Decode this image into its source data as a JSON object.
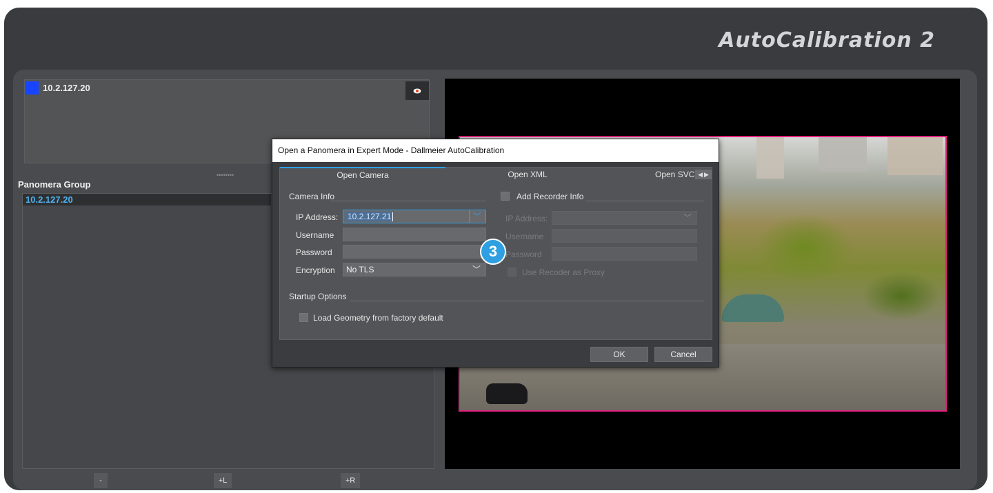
{
  "app": {
    "title": "AutoCalibration 2"
  },
  "camera_card": {
    "ip": "10.2.127.20",
    "color": "#1744ff",
    "eye_icon": "eye-icon"
  },
  "group": {
    "label": "Panomera Group",
    "items": [
      {
        "label": "10.2.127.20"
      }
    ]
  },
  "bottom_buttons": {
    "minus": "-",
    "plus_l": "+L",
    "plus_r": "+R"
  },
  "dialog": {
    "title": "Open a Panomera in Expert Mode - Dallmeier AutoCalibration",
    "tabs": [
      {
        "label": "Open Camera",
        "active": true
      },
      {
        "label": "Open XML",
        "active": false
      },
      {
        "label": "Open SVC",
        "active": false
      }
    ],
    "camera_info": {
      "section": "Camera Info",
      "ip_label": "IP Address:",
      "ip_value": "10.2.127.21",
      "username_label": "Username",
      "username_value": "",
      "password_label": "Password",
      "password_value": "",
      "encryption_label": "Encryption",
      "encryption_value": "No TLS"
    },
    "recorder_info": {
      "section": "Add Recorder Info",
      "checked": false,
      "ip_label": "IP Address:",
      "username_label": "Username",
      "password_label": "Password",
      "proxy_label": "Use Recoder as Proxy"
    },
    "startup": {
      "section": "Startup Options",
      "load_geometry_label": "Load Geometry from factory default",
      "load_geometry_checked": false
    },
    "buttons": {
      "ok": "OK",
      "cancel": "Cancel"
    }
  },
  "step_badge": {
    "number": "3",
    "color": "#2e9fe0"
  },
  "viewer": {
    "highlight_color": "#e0207d"
  }
}
